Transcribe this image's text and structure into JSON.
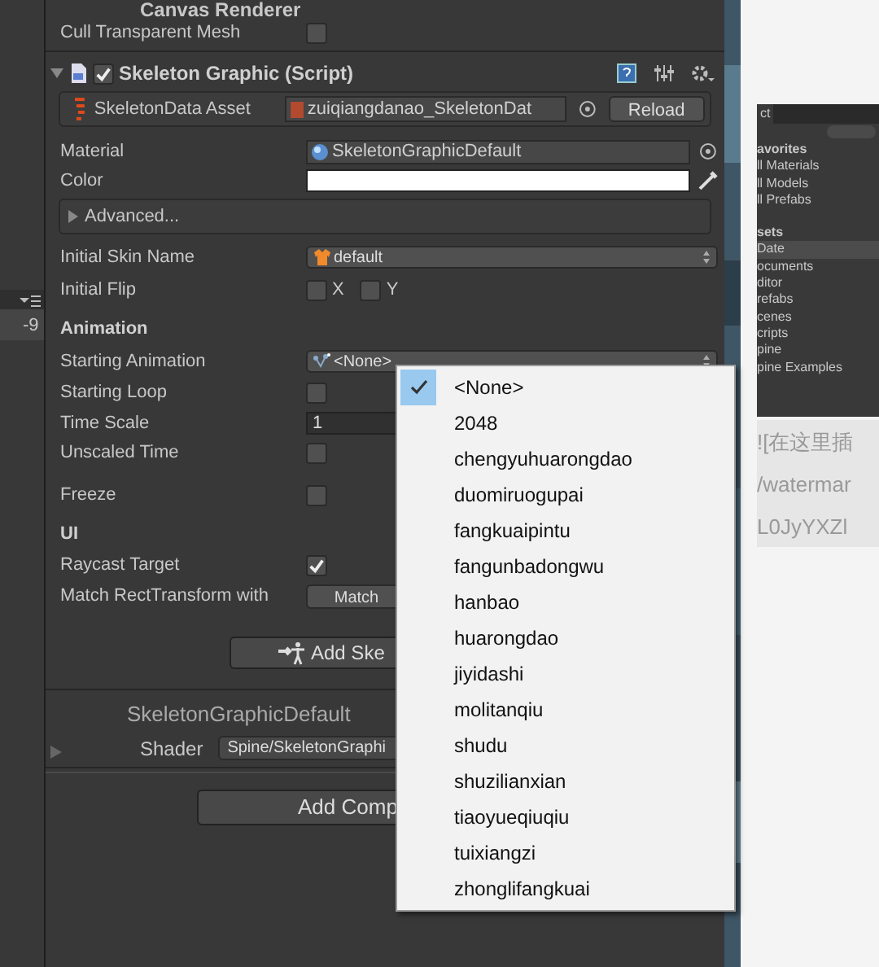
{
  "left_panel": {
    "cell": "-9"
  },
  "inspector": [
    {
      "kind": "header",
      "label": "Canvas Renderer"
    },
    {
      "kind": "checkbox",
      "label": "Cull Transparent Mesh",
      "checked": false
    },
    {
      "kind": "script",
      "label": "Skeleton Graphic (Script)",
      "enabled": true,
      "expanded": true
    },
    {
      "kind": "asset",
      "label": "SkeletonData Asset",
      "value": "zuiqiangdanao_SkeletonDat",
      "button": "Reload"
    },
    {
      "kind": "object",
      "label": "Material",
      "value": "SkeletonGraphicDefault"
    },
    {
      "kind": "color",
      "label": "Color",
      "color": "#ffffff"
    },
    {
      "kind": "foldout",
      "label": "Advanced...",
      "expanded": false
    },
    {
      "kind": "skin-dropdown",
      "label": "Initial Skin Name",
      "value": "default"
    },
    {
      "kind": "flip",
      "label": "Initial Flip",
      "options": [
        {
          "label": "X",
          "checked": false
        },
        {
          "label": "Y",
          "checked": false
        }
      ]
    },
    {
      "kind": "section",
      "label": "Animation"
    },
    {
      "kind": "animation-dropdown",
      "label": "Starting Animation",
      "value": "<None>"
    },
    {
      "kind": "checkbox",
      "label": "Starting Loop",
      "checked": false
    },
    {
      "kind": "field",
      "label": "Time Scale",
      "value": "1"
    },
    {
      "kind": "checkbox",
      "label": "Unscaled Time",
      "checked": false
    },
    {
      "kind": "checkbox",
      "label": "Freeze",
      "checked": false
    },
    {
      "kind": "section",
      "label": "UI"
    },
    {
      "kind": "checkbox",
      "label": "Raycast Target",
      "checked": true
    },
    {
      "kind": "button",
      "label": "Match RectTransform with",
      "button": "Match"
    },
    {
      "kind": "wide-button",
      "label": "Add Ske"
    },
    {
      "kind": "material",
      "label": "SkeletonGraphicDefault",
      "shader_label": "Shader",
      "shader": "Spine/SkeletonGraphi"
    },
    {
      "kind": "add-button",
      "label": "Add Comp"
    }
  ],
  "menu": [
    {
      "label": "<None>",
      "selected": true
    },
    {
      "label": "2048",
      "selected": false
    },
    {
      "label": "chengyuhuarongdao",
      "selected": false
    },
    {
      "label": "duomiruogupai",
      "selected": false
    },
    {
      "label": "fangkuaipintu",
      "selected": false
    },
    {
      "label": "fangunbadongwu",
      "selected": false
    },
    {
      "label": "hanbao",
      "selected": false
    },
    {
      "label": "huarongdao",
      "selected": false
    },
    {
      "label": "jiyidashi",
      "selected": false
    },
    {
      "label": "molitanqiu",
      "selected": false
    },
    {
      "label": "shudu",
      "selected": false
    },
    {
      "label": "shuzilianxian",
      "selected": false
    },
    {
      "label": "tiaoyueqiuqiu",
      "selected": false
    },
    {
      "label": "tuixiangzi",
      "selected": false
    },
    {
      "label": "zhonglifangkuai",
      "selected": false
    }
  ],
  "project_panel": {
    "tab": "ct",
    "items": [
      {
        "label": "avorites",
        "kind": "heading",
        "selected": false
      },
      {
        "label": "ll Materials",
        "kind": "item",
        "selected": false
      },
      {
        "label": "ll Models",
        "kind": "item",
        "selected": false
      },
      {
        "label": "ll Prefabs",
        "kind": "item",
        "selected": false
      },
      {
        "label": "sets",
        "kind": "heading",
        "selected": false
      },
      {
        "label": "Date",
        "kind": "item",
        "selected": true
      },
      {
        "label": "ocuments",
        "kind": "item",
        "selected": false
      },
      {
        "label": "ditor",
        "kind": "item",
        "selected": false
      },
      {
        "label": "refabs",
        "kind": "item",
        "selected": false
      },
      {
        "label": "cenes",
        "kind": "item",
        "selected": false
      },
      {
        "label": "cripts",
        "kind": "item",
        "selected": false
      },
      {
        "label": "pine",
        "kind": "item",
        "selected": false
      },
      {
        "label": "pine Examples",
        "kind": "item",
        "selected": false
      }
    ]
  },
  "editor_lines": [
    "![在这里插",
    "/watermar",
    "L0JyYXZl"
  ]
}
